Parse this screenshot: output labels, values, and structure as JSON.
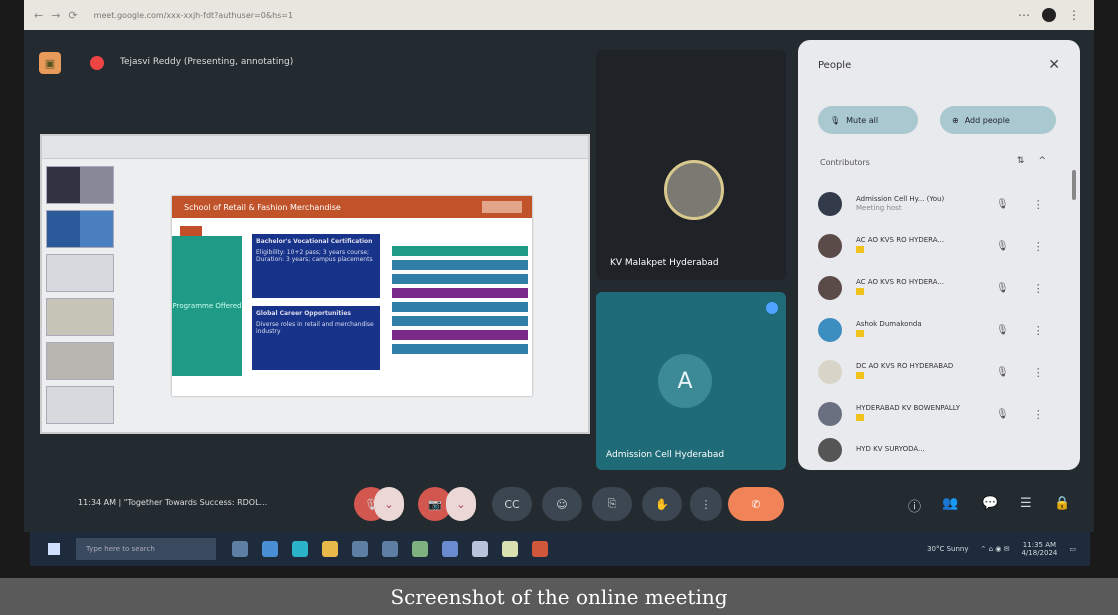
{
  "browser": {
    "url": "meet.google.com/xxx-xxjh-fdt?authuser=0&hs=1"
  },
  "meeting": {
    "presenter": "Tejasvi Reddy (Presenting, annotating)",
    "slide": {
      "title": "School of Retail & Fashion Merchandise",
      "teal_text": "Programme Offered",
      "box1_title": "Bachelor's Vocational Certification",
      "box1_text": "Eligibility: 10+2 pass; 3 years course; Duration: 3 years; campus placements",
      "box2_title": "Global Career Opportunities",
      "box2_text": "Diverse roles in retail and merchandise industry"
    },
    "tile_logo_name": "KV Malakpet Hyderabad",
    "tile_a_letter": "A",
    "tile_a_name": "Admission Cell Hyderabad",
    "bottom_info": "11:34 AM | \"Together Towards Success: RDOL..."
  },
  "people": {
    "title": "People",
    "mute_all": "Mute all",
    "add_people": "Add people",
    "contributors": "Contributors",
    "rows": [
      {
        "name": "Admission Cell Hy... (You)",
        "sub": "Meeting host"
      },
      {
        "name": "AC AO KVS RO HYDERA...",
        "sub": ""
      },
      {
        "name": "AC AO KVS RO HYDERA...",
        "sub": ""
      },
      {
        "name": "Ashok Dumakonda",
        "sub": ""
      },
      {
        "name": "DC AO KVS RO HYDERABAD",
        "sub": ""
      },
      {
        "name": "HYDERABAD KV BOWENPALLY",
        "sub": ""
      },
      {
        "name": "HYD KV SURYODA...",
        "sub": ""
      }
    ]
  },
  "taskbar": {
    "search_placeholder": "Type here to search",
    "weather": "30°C Sunny",
    "time": "11:35 AM",
    "date": "4/18/2024"
  },
  "caption": "Screenshot of the online meeting",
  "colors": {
    "meet_bg": "#232a30",
    "slide_header": "#c0532a",
    "slide_teal": "#1e9a86",
    "mic_red": "#d2574e"
  }
}
